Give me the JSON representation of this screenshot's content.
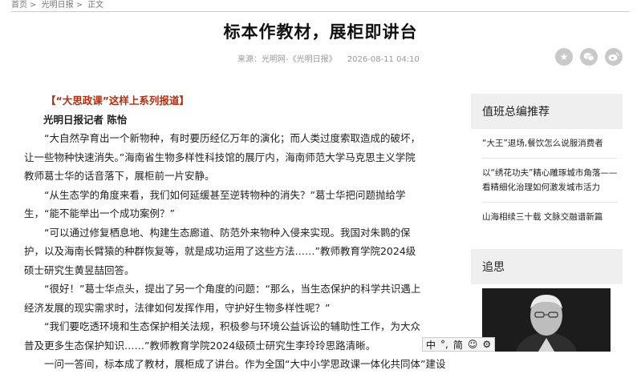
{
  "breadcrumb": {
    "items": [
      "首页",
      "光明日报",
      "正文"
    ],
    "separator": ">"
  },
  "article": {
    "title": "标本作教材，展柜即讲台",
    "source": "来源：光明网-《光明日报》",
    "date": "2026-08-11 04:10",
    "series_link": "【“大思政课”这样上系列报道】",
    "byline": "光明日报记者 陈怡",
    "paragraphs": [
      "“大自然孕育出一个新物种，有时要历经亿万年的演化；而人类过度索取造成的破坏，让一些物种快速消失。”海南省生物多样性科技馆的展厅内，海南师范大学马克思主义学院教师葛士华的话音落下，展柜前一片安静。",
      "“从生态学的角度来看，我们如何延缓甚至逆转物种的消失？”葛士华把问题抛给学生，“能不能举出一个成功案例？”",
      "“可以通过修复栖息地、构建生态廊道、防范外来物种入侵来实现。我国对朱鹮的保护，以及海南长臂猿的种群恢复等，就是成功运用了这些方法……”教师教育学院2024级硕士研究生黄昱喆回答。",
      "“很好！”葛士华点头，提出了另一个角度的问题：“那么，当生态保护的科学共识遇上经济发展的现实需求时，法律如何发挥作用，守护好生物多样性呢？”",
      "“我们要吃透环境和生态保护相关法规，积极参与环境公益诉讼的辅助性工作，为大众普及更多生态保护知识……”教师教育学院2024级硕士研究生李玲玲思路清晰。",
      "一问一答间，标本成了教材，展柜成了讲台。作为全国“大中小学思政课一体化共同体”建设"
    ]
  },
  "share": {
    "icons": [
      "star-icon",
      "wechat-icon",
      "weibo-icon"
    ],
    "color": "#c9c9c9"
  },
  "sidebar": {
    "picks_title": "值班总编推荐",
    "picks": [
      "“大王”退场,餐饮怎么说服消费者",
      "以“绣花功夫”精心雕琢城市角落——看精细化治理如何激发城市活力",
      "山海相续三十载 文脉交融谱新篇"
    ],
    "memorial_title": "追思"
  },
  "ime": {
    "mode": "中",
    "punct": "°,",
    "script": "简",
    "emoji": "☺",
    "settings": "⚙"
  },
  "colors": {
    "series_link": "#b03012",
    "sidebar_header_bg": "#efefef"
  }
}
